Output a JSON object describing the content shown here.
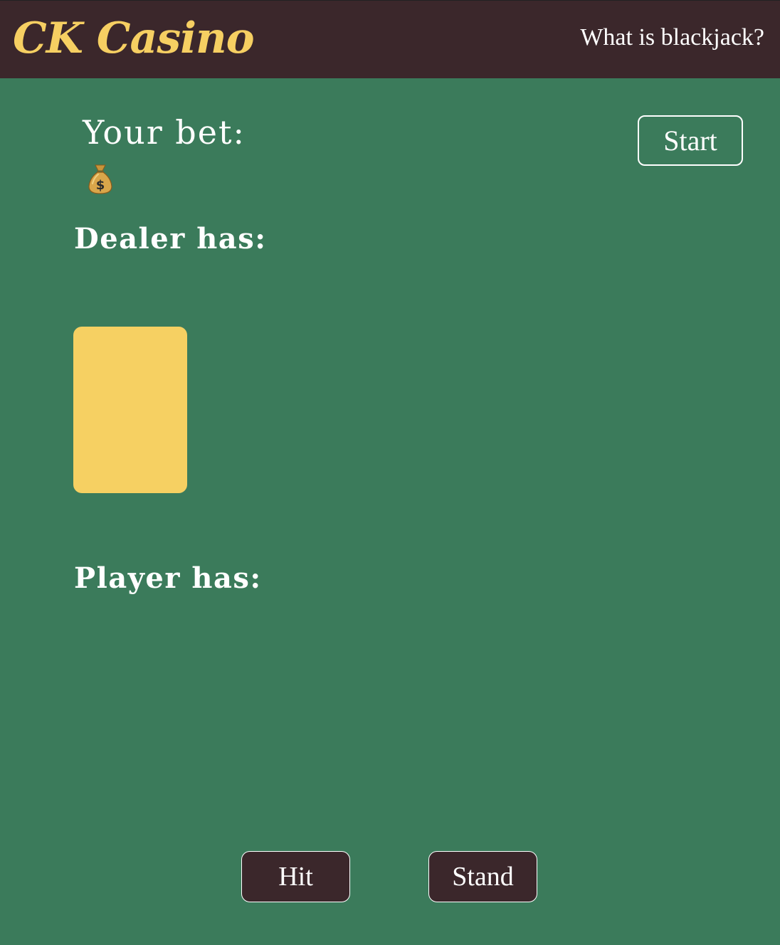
{
  "header": {
    "logo_text": "CK Casino",
    "help_link": "What is blackjack?"
  },
  "bet": {
    "label": "Your bet:",
    "icon": "money-bag-icon"
  },
  "controls": {
    "start_label": "Start",
    "hit_label": "Hit",
    "stand_label": "Stand"
  },
  "dealer": {
    "label": "Dealer has:",
    "card": "face-down"
  },
  "player": {
    "label": "Player has:"
  },
  "colors": {
    "table_green": "#3b7b5b",
    "header_brown": "#3b272b",
    "accent_gold": "#f6cf62"
  }
}
